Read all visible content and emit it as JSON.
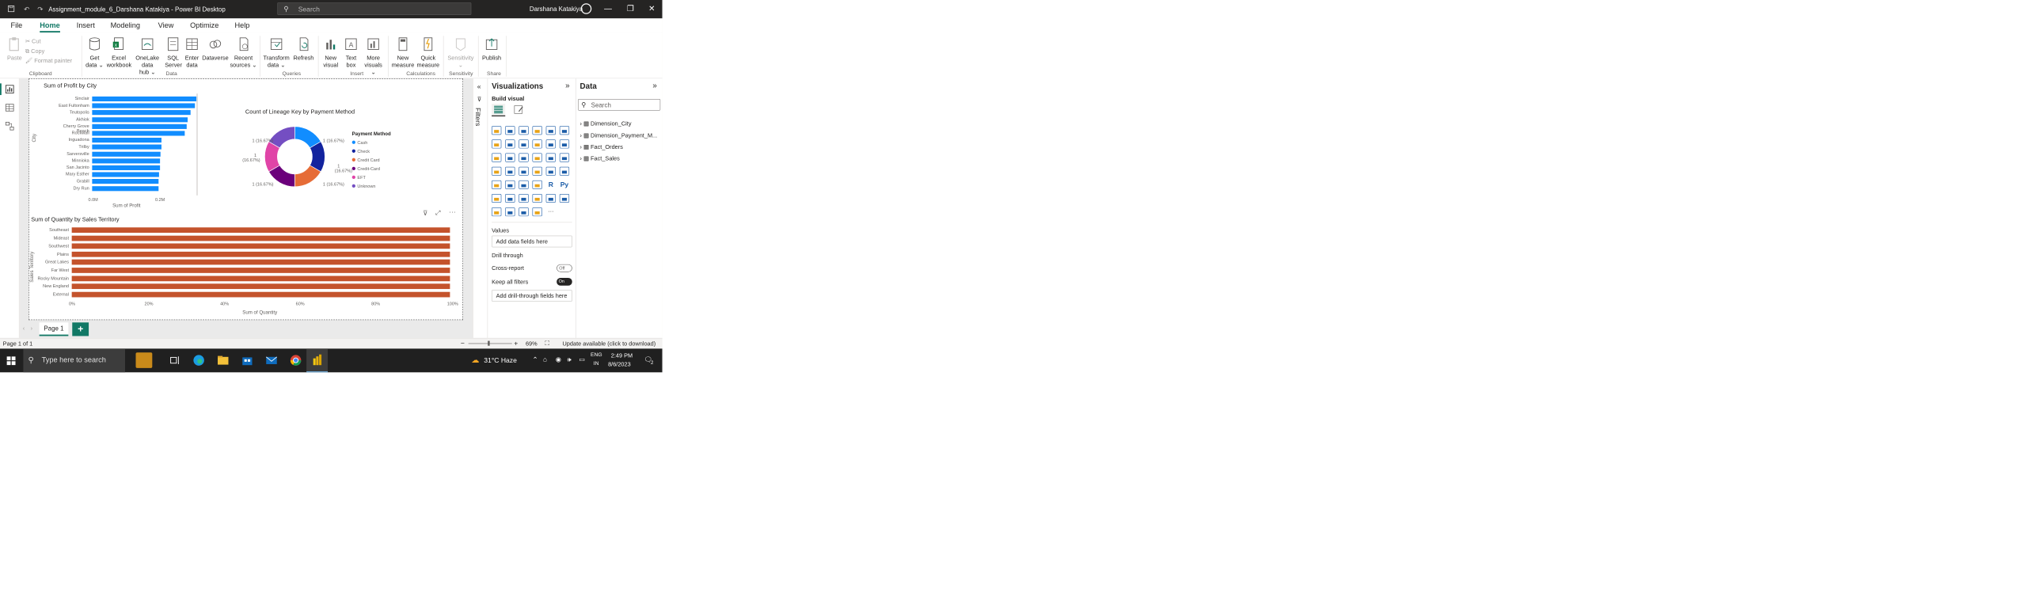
{
  "window": {
    "title": "Assignment_module_6_Darshana Katakiya - Power BI Desktop",
    "search_placeholder": "Search",
    "user_name": "Darshana Katakiya"
  },
  "ribbon_tabs": [
    "File",
    "Home",
    "Insert",
    "Modeling",
    "View",
    "Optimize",
    "Help"
  ],
  "ribbon": {
    "clipboard": {
      "paste": "Paste",
      "cut": "Cut",
      "copy": "Copy",
      "format_painter": "Format painter",
      "group": "Clipboard"
    },
    "data": {
      "get_data_1": "Get",
      "get_data_2": "data ⌄",
      "excel_1": "Excel",
      "excel_2": "workbook",
      "onelake_1": "OneLake data",
      "onelake_2": "hub ⌄",
      "sql_1": "SQL",
      "sql_2": "Server",
      "enter_1": "Enter",
      "enter_2": "data",
      "dataverse": "Dataverse",
      "recent_1": "Recent",
      "recent_2": "sources ⌄",
      "group": "Data"
    },
    "queries": {
      "transform_1": "Transform",
      "transform_2": "data ⌄",
      "refresh": "Refresh",
      "group": "Queries"
    },
    "insert": {
      "newvisual_1": "New",
      "newvisual_2": "visual",
      "textbox_1": "Text",
      "textbox_2": "box",
      "more_1": "More",
      "more_2": "visuals ⌄",
      "group": "Insert"
    },
    "calculations": {
      "newmeasure_1": "New",
      "newmeasure_2": "measure",
      "quick_1": "Quick",
      "quick_2": "measure",
      "group": "Calculations"
    },
    "sensitivity": {
      "label": "Sensitivity",
      "label_2": "⌄",
      "group": "Sensitivity"
    },
    "share": {
      "publish": "Publish",
      "group": "Share"
    }
  },
  "profit_chart": {
    "title": "Sum of Profit by City",
    "ylabel": "City",
    "xlabel": "Sum of Profit",
    "ticks": [
      "0.0M",
      "0.2M"
    ]
  },
  "donut_chart": {
    "title": "Count of Lineage Key by Payment Method",
    "legend_title": "Payment Method",
    "labels": [
      "1 (16.67%)",
      "1 (16.67%)",
      "1",
      "(16.67%)",
      "1",
      "(16.67%)",
      "1 (16.67%)",
      "1 (16.67%)"
    ]
  },
  "territory_chart": {
    "title": "Sum of Quantity by Sales Territory",
    "ylabel": "Sales Territory",
    "xlabel": "Sum of Quantity",
    "ticks": [
      "0%",
      "20%",
      "40%",
      "60%",
      "80%",
      "100%"
    ]
  },
  "chart_data": [
    {
      "type": "bar",
      "title": "Sum of Profit by City",
      "xlabel": "Sum of Profit",
      "ylabel": "City",
      "orientation": "horizontal",
      "categories": [
        "Sinclair",
        "East Fultonham",
        "Teutopolis",
        "Akhiok",
        "Cherry Grove Beach",
        "Rockwall",
        "Inguadona",
        "Trilby",
        "Sarversville",
        "Minnioka",
        "San Jacinto",
        "Mary Esther",
        "Grabill",
        "Dry Run"
      ],
      "values": [
        0.29,
        0.282,
        0.27,
        0.262,
        0.26,
        0.255,
        0.19,
        0.19,
        0.188,
        0.187,
        0.186,
        0.184,
        0.183,
        0.182
      ],
      "xlim": [
        0,
        0.3
      ],
      "xticks": [
        "0.0M",
        "0.2M"
      ],
      "color": "#118dff"
    },
    {
      "type": "pie",
      "title": "Count of Lineage Key by Payment Method",
      "donut": true,
      "legend_title": "Payment Method",
      "categories": [
        "Cash",
        "Check",
        "Credit Card",
        "Credit-Card",
        "EFT",
        "Unknown"
      ],
      "values": [
        1,
        1,
        1,
        1,
        1,
        1
      ],
      "colors": [
        "#118dff",
        "#12239e",
        "#e66c37",
        "#6b007b",
        "#e044a7",
        "#744ec2"
      ]
    },
    {
      "type": "bar",
      "title": "Sum of Quantity by Sales Territory",
      "xlabel": "Sum of Quantity",
      "ylabel": "Sales Territory",
      "orientation": "horizontal",
      "stacked_100": true,
      "categories": [
        "Southeast",
        "Mideast",
        "Southwest",
        "Plains",
        "Great Lakes",
        "Far West",
        "Rocky Mountain",
        "New England",
        "External"
      ],
      "values": [
        100,
        100,
        100,
        100,
        100,
        100,
        100,
        100,
        100
      ],
      "xlim": [
        0,
        100
      ],
      "xticks": [
        "0%",
        "20%",
        "40%",
        "60%",
        "80%",
        "100%"
      ],
      "color": "#c4532c"
    }
  ],
  "pages": {
    "page1": "Page 1",
    "add": "+"
  },
  "status": {
    "page": "Page 1 of 1",
    "zoom": "69%",
    "update": "Update available (click to download)"
  },
  "filters_label": "Filters",
  "viz_pane": {
    "title": "Visualizations",
    "build": "Build visual",
    "values_label": "Values",
    "add_data": "Add data fields here",
    "drill_through": "Drill through",
    "cross_report": "Cross-report",
    "cross_report_state": "Off",
    "keep_filters": "Keep all filters",
    "keep_filters_state": "On",
    "add_drill": "Add drill-through fields here",
    "more": "···"
  },
  "data_pane": {
    "title": "Data",
    "search_placeholder": "Search",
    "tables": [
      "Dimension_City",
      "Dimension_Payment_M...",
      "Fact_Orders",
      "Fact_Sales"
    ]
  },
  "taskbar": {
    "search_placeholder": "Type here to search",
    "weather": "31°C  Haze",
    "lang_1": "ENG",
    "lang_2": "IN",
    "time": "2:49 PM",
    "date": "8/6/2023",
    "notif": "2"
  }
}
